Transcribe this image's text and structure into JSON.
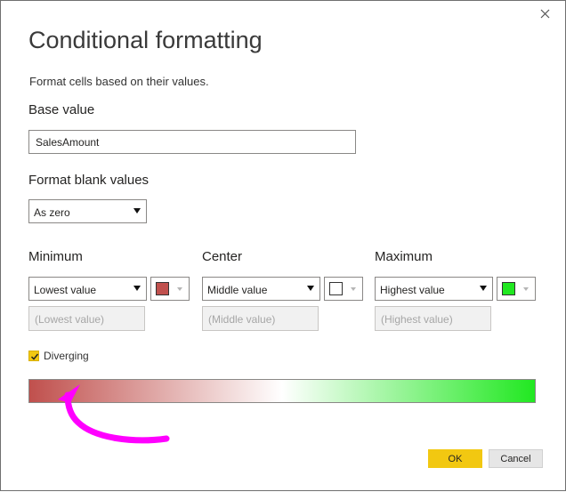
{
  "dialog": {
    "title": "Conditional formatting",
    "subtitle": "Format cells based on their values."
  },
  "base_value": {
    "label": "Base value",
    "value": "SalesAmount"
  },
  "blank_values": {
    "label": "Format blank values",
    "selected": "As zero"
  },
  "minimum": {
    "label": "Minimum",
    "selected": "Lowest value",
    "placeholder": "(Lowest value)",
    "color": "#c0504d"
  },
  "center": {
    "label": "Center",
    "selected": "Middle value",
    "placeholder": "(Middle value)",
    "color": "#ffffff"
  },
  "maximum": {
    "label": "Maximum",
    "selected": "Highest value",
    "placeholder": "(Highest value)",
    "color": "#21e821"
  },
  "diverging": {
    "label": "Diverging",
    "checked": true
  },
  "buttons": {
    "ok": "OK",
    "cancel": "Cancel"
  },
  "colors": {
    "accent": "#f2c811",
    "annotation_arrow": "#ff00ff"
  },
  "icons": {
    "close": "close-icon",
    "checkmark": "checkmark-icon",
    "dropdown": "chevron-down-icon"
  }
}
